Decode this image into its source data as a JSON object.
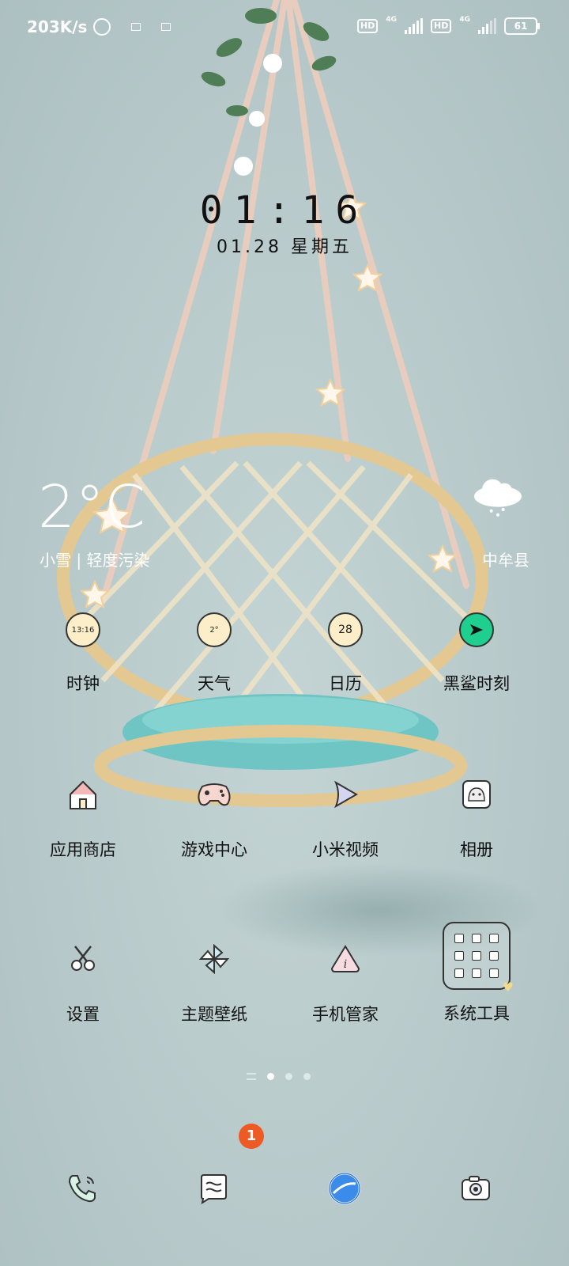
{
  "status_bar": {
    "net_speed": "203K/s",
    "sim1_badge": "HD",
    "sim1_net": "4G",
    "sim2_badge": "HD",
    "sim2_net": "4G",
    "battery": "61"
  },
  "clock": {
    "time": "01:16",
    "date": "01.28 星期五"
  },
  "weather": {
    "temperature": "2°C",
    "description": "小雪 | 轻度污染",
    "city": "中牟县",
    "icon": "snow-cloud-icon"
  },
  "apps_row1": [
    {
      "label": "时钟",
      "icon_text": "13:16",
      "icon": "clock-icon"
    },
    {
      "label": "天气",
      "icon_text": "2°",
      "icon": "weather-icon"
    },
    {
      "label": "日历",
      "icon_text": "28",
      "icon": "calendar-icon"
    },
    {
      "label": "黑鲨时刻",
      "icon": "send-icon"
    }
  ],
  "apps_row2": [
    {
      "label": "应用商店",
      "icon": "house-icon"
    },
    {
      "label": "游戏中心",
      "icon": "gamepad-icon"
    },
    {
      "label": "小米视频",
      "icon": "play-icon"
    },
    {
      "label": "相册",
      "icon": "ghost-photo-icon"
    }
  ],
  "apps_row3": [
    {
      "label": "设置",
      "icon": "scissors-icon"
    },
    {
      "label": "主题壁纸",
      "icon": "pinwheel-icon"
    },
    {
      "label": "手机管家",
      "icon": "info-shield-icon"
    },
    {
      "label": "系统工具",
      "icon": "folder-icon"
    }
  ],
  "dock": [
    {
      "name": "phone",
      "icon": "phone-icon"
    },
    {
      "name": "messages",
      "icon": "message-icon",
      "badge": "1"
    },
    {
      "name": "browser",
      "icon": "globe-icon"
    },
    {
      "name": "camera",
      "icon": "camera-icon"
    }
  ],
  "colors": {
    "background": "#b9cacb",
    "badge": "#ee5a24",
    "icon_fill": "#fbeec8",
    "send_icon": "#1fcf8f"
  }
}
